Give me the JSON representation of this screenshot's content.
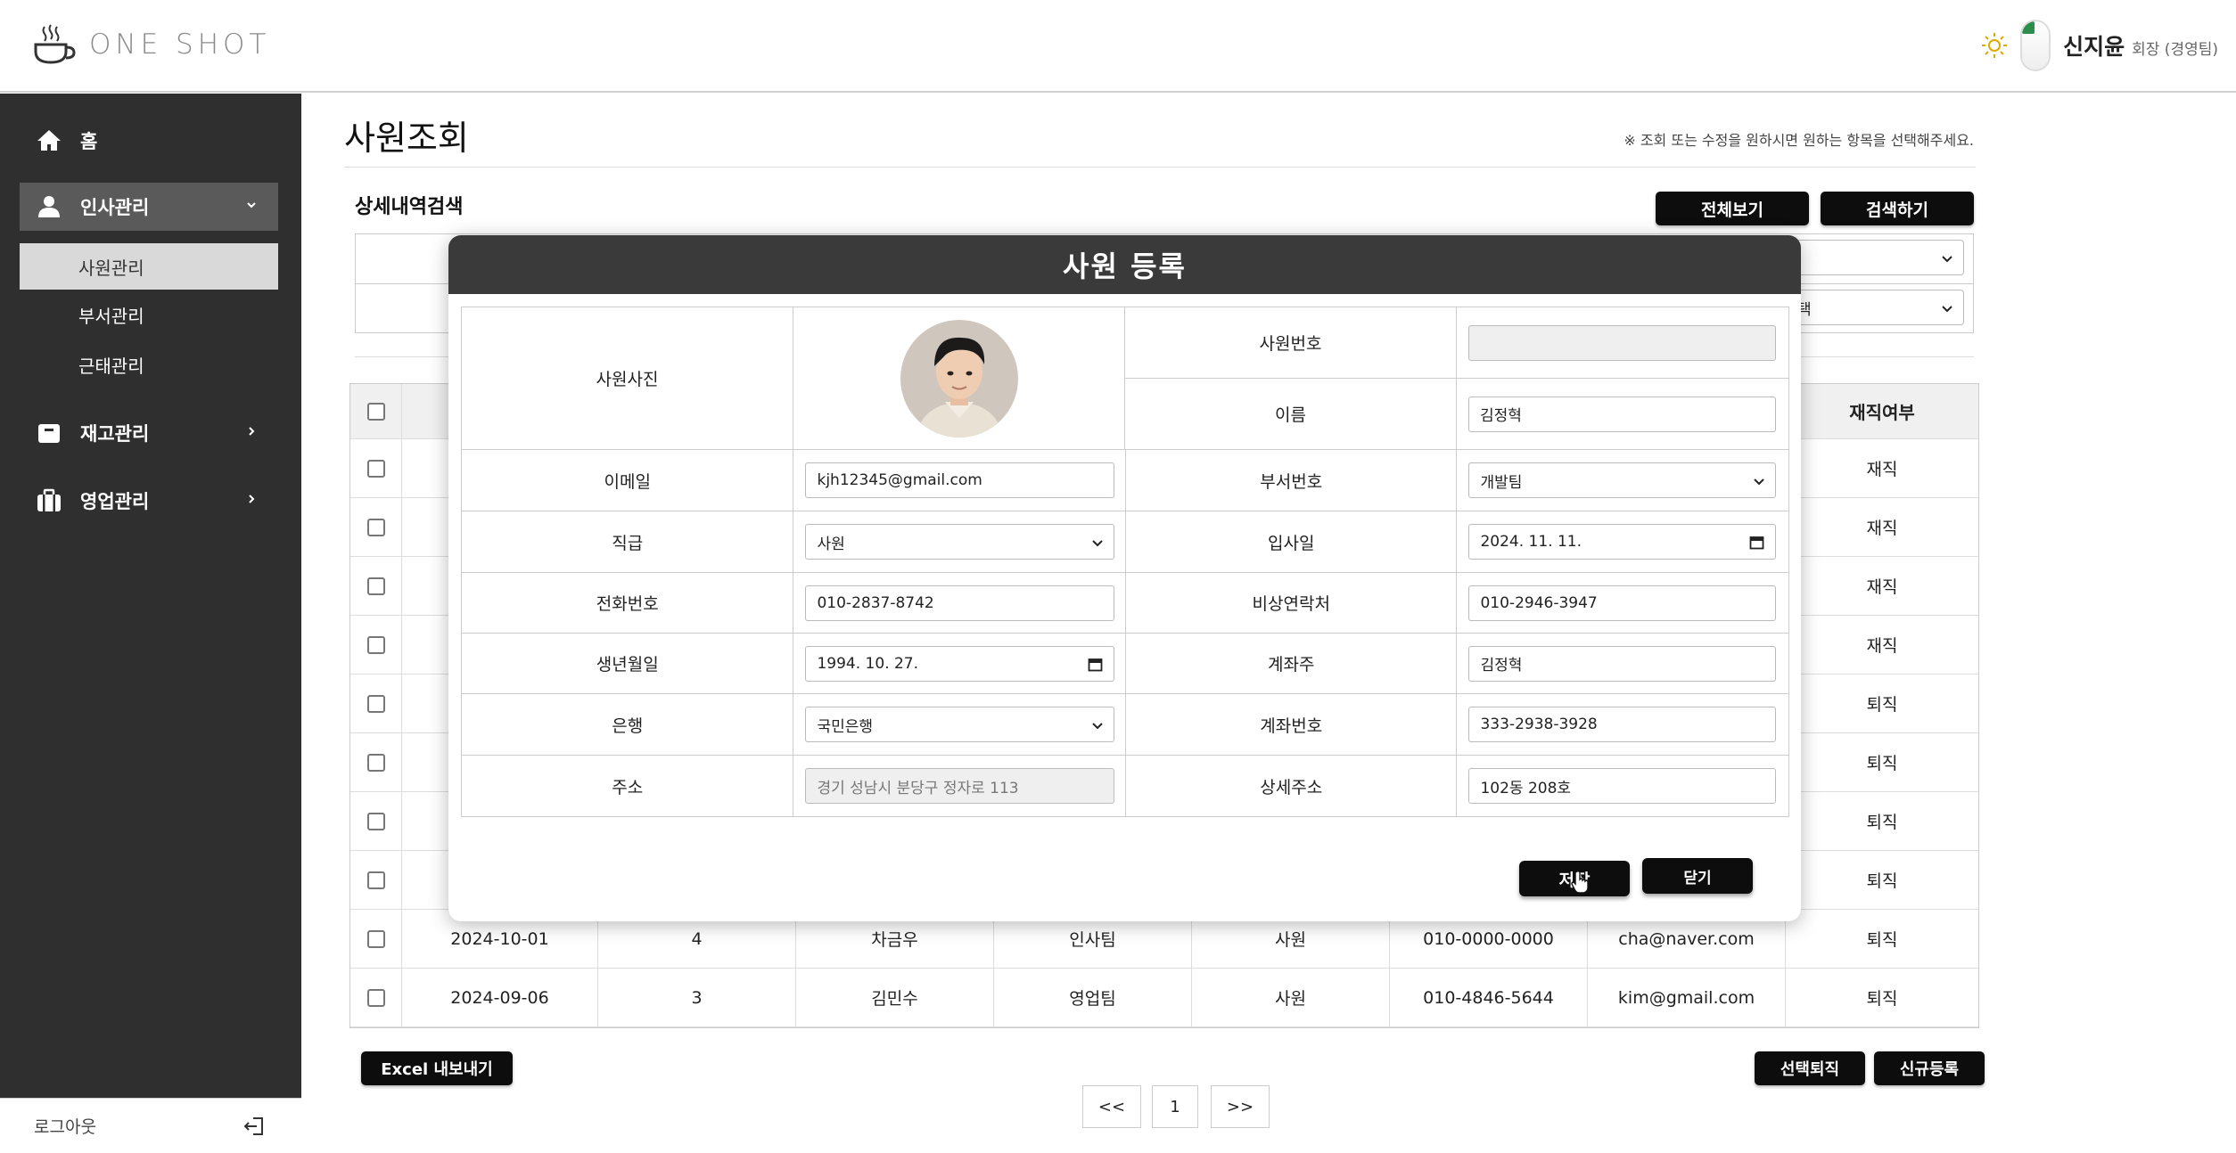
{
  "brand": {
    "logo_text": "ONE SHOT"
  },
  "header": {
    "user_name": "신지윤",
    "user_role": "회장 (경영팀)"
  },
  "sidebar": {
    "items": [
      {
        "label": "홈",
        "icon": "home-icon"
      },
      {
        "label": "인사관리",
        "icon": "person-icon",
        "expanded": true,
        "sub": [
          {
            "label": "사원관리"
          },
          {
            "label": "부서관리"
          },
          {
            "label": "근태관리"
          }
        ]
      },
      {
        "label": "재고관리",
        "icon": "box-icon"
      },
      {
        "label": "영업관리",
        "icon": "briefcase-icon"
      }
    ],
    "logout_label": "로그아웃"
  },
  "page": {
    "title": "사원조회",
    "notice": "※ 조회 또는 수정을 원하시면 원하는 항목을 선택해주세요.",
    "search_section_title": "상세내역검색",
    "view_all_label": "전체보기",
    "search_label": "검색하기",
    "search_select_2_value": "택"
  },
  "table": {
    "visible_header": "재직여부",
    "rows": [
      {
        "status": "재직"
      },
      {
        "status": "재직"
      },
      {
        "status": "재직"
      },
      {
        "status": "재직"
      },
      {
        "status": "퇴직"
      },
      {
        "status": "퇴직"
      },
      {
        "status": "퇴직"
      },
      {
        "status": "퇴직"
      },
      {
        "date": "2024-10-01",
        "no": "4",
        "name": "차금우",
        "dept": "인사팀",
        "rank": "사원",
        "phone": "010-0000-0000",
        "email": "cha@naver.com",
        "status": "퇴직"
      },
      {
        "date": "2024-09-06",
        "no": "3",
        "name": "김민수",
        "dept": "영업팀",
        "rank": "사원",
        "phone": "010-4846-5644",
        "email": "kim@gmail.com",
        "status": "퇴직"
      }
    ]
  },
  "footer": {
    "excel_label": "Excel 내보내기",
    "retire_label": "선택퇴직",
    "new_label": "신규등록",
    "pager_prev": "<<",
    "pager_page": "1",
    "pager_next": ">>"
  },
  "modal": {
    "title": "사원 등록",
    "labels": {
      "photo": "사원사진",
      "emp_no": "사원번호",
      "name": "이름",
      "email": "이메일",
      "dept_no": "부서번호",
      "rank": "직급",
      "hire_date": "입사일",
      "phone": "전화번호",
      "emergency": "비상연락처",
      "birth": "생년월일",
      "account_holder": "계좌주",
      "bank": "은행",
      "account_no": "계좌번호",
      "address": "주소",
      "address_detail": "상세주소"
    },
    "values": {
      "emp_no": "",
      "name": "김정혁",
      "email": "kjh12345@gmail.com",
      "dept_no": "개발팀",
      "rank": "사원",
      "hire_date": "2024. 11. 11.",
      "phone": "010-2837-8742",
      "emergency": "010-2946-3947",
      "birth": "1994. 10. 27.",
      "account_holder": "김정혁",
      "bank": "국민은행",
      "account_no": "333-2938-3928",
      "address": "경기 성남시 분당구 정자로 113",
      "address_detail": "102동 208호"
    },
    "save_label": "저장",
    "close_label": "닫기"
  }
}
